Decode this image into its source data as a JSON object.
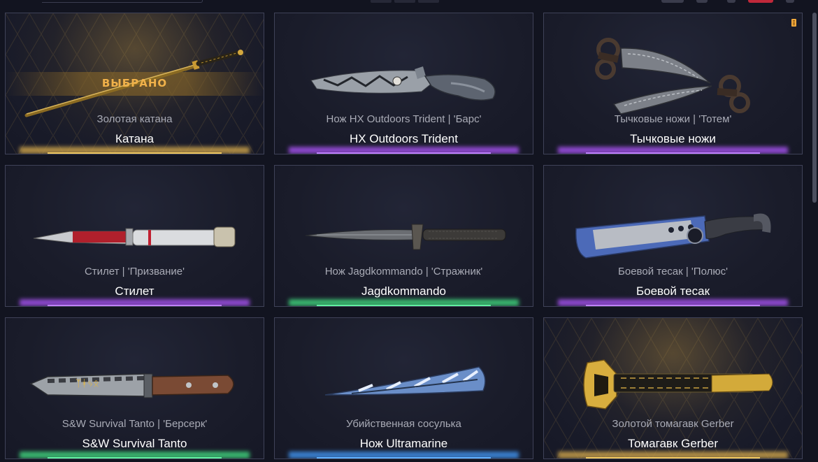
{
  "selected_label": "ВЫБРАНО",
  "cards": [
    {
      "subtitle": "Золотая катана",
      "title": "Катана",
      "glow": "#c9a04a"
    },
    {
      "subtitle": "Нож HX Outdoors Trident | 'Барс'",
      "title": "HX Outdoors Trident",
      "glow": "#a050e8"
    },
    {
      "subtitle": "Тычковые ножи | 'Тотем'",
      "title": "Тычковые ножи",
      "glow": "#a050e8"
    },
    {
      "subtitle": "Стилет | 'Призвание'",
      "title": "Стилет",
      "glow": "#a050e8"
    },
    {
      "subtitle": "Нож Jagdkommando | 'Стражник'",
      "title": "Jagdkommando",
      "glow": "#3fcf7a"
    },
    {
      "subtitle": "Боевой тесак | 'Полюс'",
      "title": "Боевой тесак",
      "glow": "#a050e8"
    },
    {
      "subtitle": "S&W Survival Tanto | 'Берсерк'",
      "title": "S&W Survival Tanto",
      "glow": "#3fcf7a"
    },
    {
      "subtitle": "Убийственная сосулька",
      "title": "Нож Ultramarine",
      "glow": "#3f8fe8"
    },
    {
      "subtitle": "Золотой томагавк Gerber",
      "title": "Томагавк Gerber",
      "glow": "#c9a04a"
    }
  ],
  "colors": {
    "background": "#121420",
    "card_border": "#3f4258",
    "selected_text": "#f0b14a",
    "subtitle": "#a9abb6"
  },
  "icons": [
    "filter-icon",
    "settings-icon"
  ]
}
